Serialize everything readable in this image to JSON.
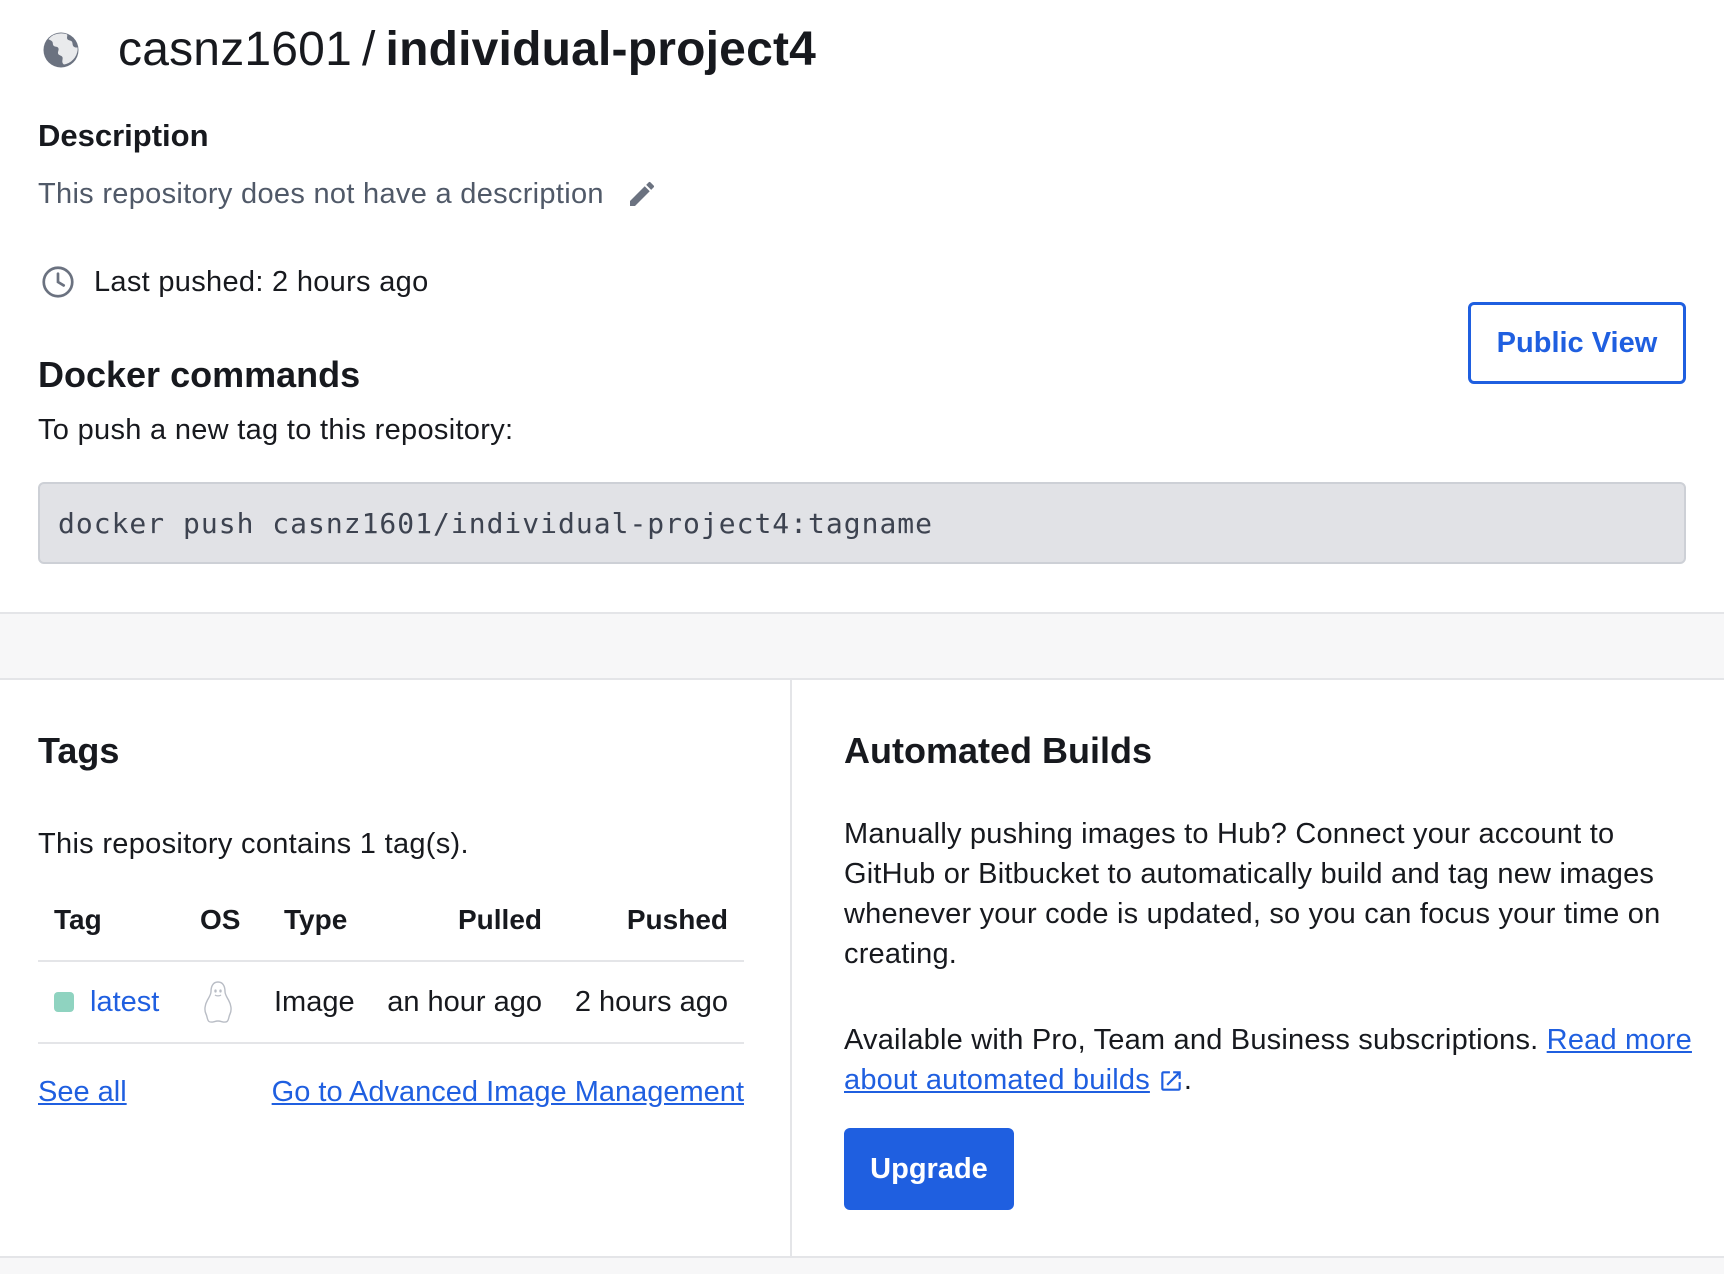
{
  "repo": {
    "namespace": "casnz1601",
    "separator": "/",
    "name": "individual-project4"
  },
  "description": {
    "heading": "Description",
    "text": "This repository does not have a description"
  },
  "last_pushed": "Last pushed: 2 hours ago",
  "public_view_label": "Public View",
  "docker_commands": {
    "heading": "Docker commands",
    "subtitle": "To push a new tag to this repository:",
    "command": "docker push casnz1601/individual-project4:tagname"
  },
  "tags": {
    "heading": "Tags",
    "count_text": "This repository contains 1 tag(s).",
    "columns": [
      "Tag",
      "OS",
      "Type",
      "Pulled",
      "Pushed"
    ],
    "rows": [
      {
        "tag": "latest",
        "os": "linux-icon",
        "type": "Image",
        "pulled": "an hour ago",
        "pushed": "2 hours ago",
        "status_color": "#8fd3c0"
      }
    ],
    "see_all": "See all",
    "advanced_link": "Go to Advanced Image Management"
  },
  "automated_builds": {
    "heading": "Automated Builds",
    "body": "Manually pushing images to Hub? Connect your account to GitHub or Bitbucket to automatically build and tag new images whenever your code is updated, so you can focus your time on creating.",
    "availability": "Available with Pro, Team and Business subscriptions.",
    "read_more": "Read more about automated builds",
    "trailing": ".",
    "upgrade_label": "Upgrade"
  },
  "colors": {
    "accent": "#1f5fe0",
    "command_bg": "#e1e2e6",
    "status_dot": "#8fd3c0"
  }
}
